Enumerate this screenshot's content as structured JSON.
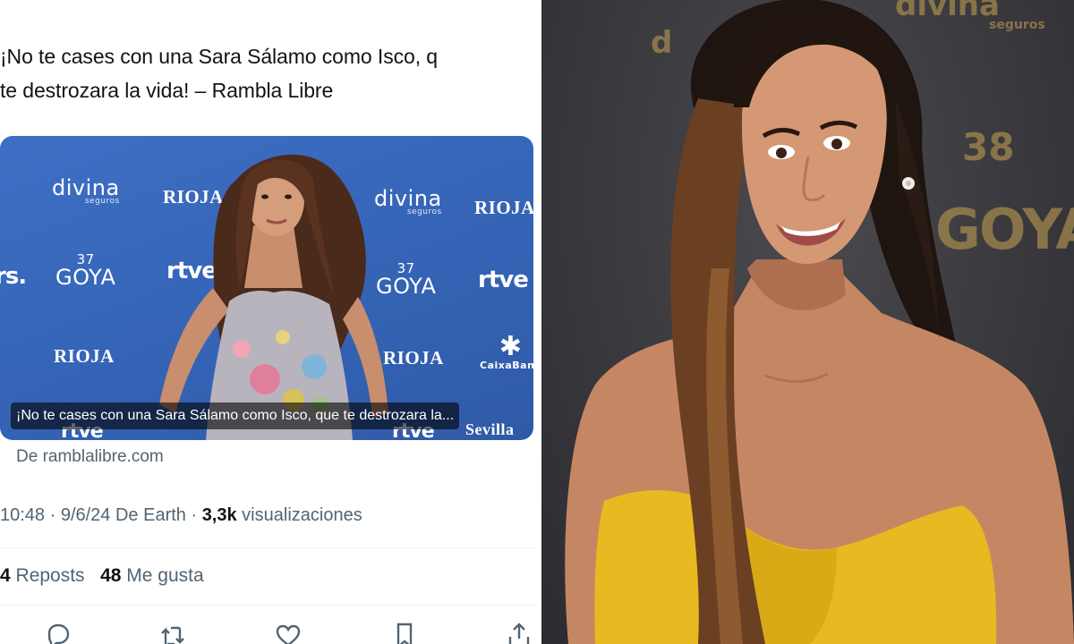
{
  "tweet": {
    "text_line_1": "¡No te cases con una Sara Sálamo como Isco, q",
    "text_line_2": "te destrozara la vida! – Rambla Libre",
    "card": {
      "caption": "¡No te cases con una Sara Sálamo como Isco, que te destrozara la...",
      "source": "De ramblalibre.com",
      "backdrop_logos": {
        "divina": "divina",
        "divina_sub": "seguros",
        "rioja": "RIOJA",
        "rtve": "rtve",
        "goya_num": "37",
        "goya": "GOYA",
        "caixa": "CaixaBank",
        "sevilla": "Sevilla"
      }
    },
    "meta": {
      "time_date": "10:48 · 9/6/24 De Earth · ",
      "views_count": "3,3k",
      "views_label": " visualizaciones"
    },
    "stats": {
      "reposts_count": "4",
      "reposts_label": " Reposts",
      "likes_count": "48",
      "likes_label": " Me gusta"
    },
    "actions": [
      "reply-icon",
      "repost-icon",
      "like-icon",
      "bookmark-icon",
      "share-icon"
    ]
  },
  "photo": {
    "backdrop_top": "divina",
    "backdrop_top_sub": "seguros",
    "backdrop_goya_num": "38",
    "backdrop_goya": "GOYA"
  },
  "colors": {
    "text": "#0f1419",
    "muted": "#536471",
    "card_blue": "#3767ba",
    "dress_yellow": "#e8b920",
    "backdrop_gold": "#a3884c"
  }
}
